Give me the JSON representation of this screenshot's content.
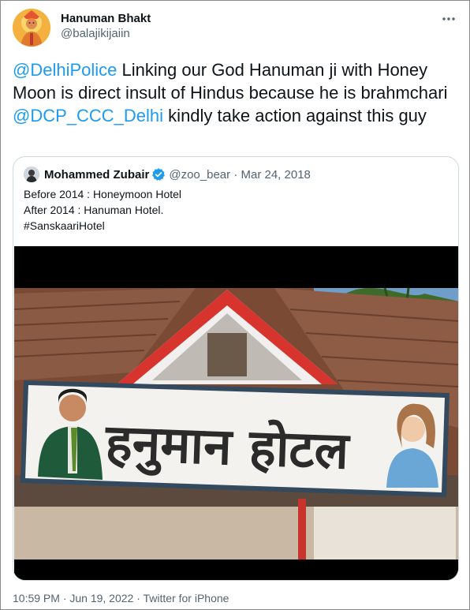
{
  "tweet": {
    "author_name": "Hanuman Bhakt",
    "author_handle": "@balajikijaiin",
    "text_parts": [
      {
        "kind": "mention",
        "text": "@DelhiPolice"
      },
      {
        "kind": "text",
        "text": " Linking our God Hanuman ji with Honey Moon is direct insult of Hindus  because he is brahmchari "
      },
      {
        "kind": "mention",
        "text": "@DCP_CCC_Delhi"
      },
      {
        "kind": "text",
        "text": " kindly take action against this guy"
      }
    ],
    "timestamp": "10:59 PM · Jun 19, 2022 · Twitter for iPhone"
  },
  "quoted": {
    "author_name": "Mohammed Zubair",
    "author_handle": "@zoo_bear",
    "separator": "·",
    "date": "Mar 24, 2018",
    "lines": [
      "Before 2014 : Honeymoon Hotel",
      "After 2014 : Hanuman Hotel.",
      "#SanskaariHotel"
    ],
    "media": {
      "sign_text": "हनुमान होटल"
    }
  },
  "icons": {
    "more": "more-horizontal-icon",
    "verified": "verified-badge-icon"
  },
  "colors": {
    "link": "#1d9bf0",
    "secondary_text": "#536471",
    "primary_text": "#0f1419",
    "border": "#cfd9de"
  }
}
